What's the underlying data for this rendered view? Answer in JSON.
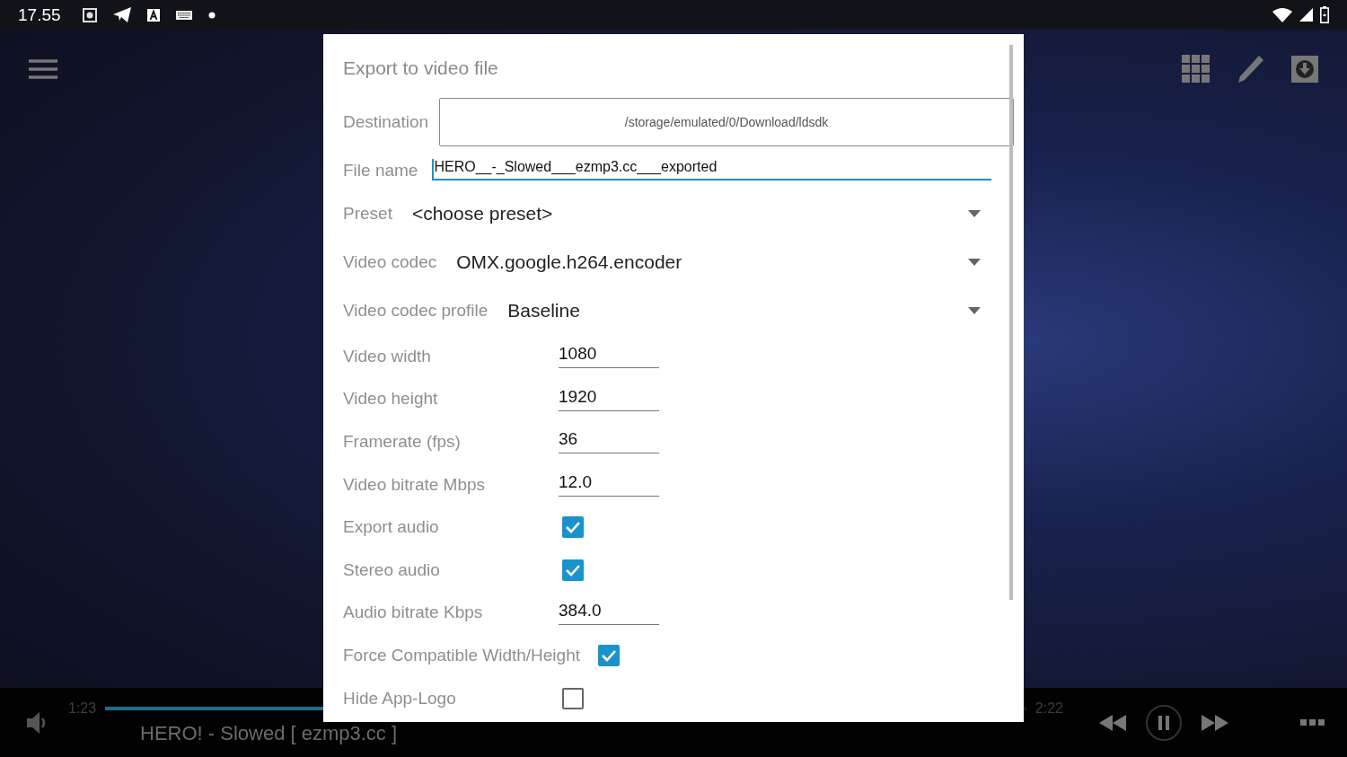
{
  "status_bar": {
    "time": "17.55"
  },
  "dialog": {
    "title": "Export to video file",
    "destination": {
      "label": "Destination",
      "value": "/storage/emulated/0/Download/ldsdk"
    },
    "file_name": {
      "label": "File name",
      "value": "HERO__-_Slowed___ezmp3.cc___exported",
      "focused": true
    },
    "rows": [
      {
        "kind": "dropdown",
        "label": "Preset",
        "value": "<choose preset>"
      },
      {
        "kind": "dropdown",
        "label": "Video codec",
        "value": "OMX.google.h264.encoder"
      },
      {
        "kind": "dropdown",
        "label": "Video codec profile",
        "value": "Baseline"
      },
      {
        "kind": "text",
        "label": "Video width",
        "value": "1080"
      },
      {
        "kind": "text",
        "label": "Video height",
        "value": "1920"
      },
      {
        "kind": "text",
        "label": "Framerate (fps)",
        "value": "36"
      },
      {
        "kind": "text",
        "label": "Video bitrate Mbps",
        "value": "12.0"
      },
      {
        "kind": "checkbox",
        "label": "Export audio",
        "checked": true
      },
      {
        "kind": "checkbox",
        "label": "Stereo audio",
        "checked": true
      },
      {
        "kind": "text",
        "label": "Audio bitrate Kbps",
        "value": "384.0"
      },
      {
        "kind": "checkbox",
        "label": "Force Compatible Width/Height",
        "checked": true
      },
      {
        "kind": "checkbox",
        "label": "Hide App-Logo",
        "checked": false
      }
    ]
  },
  "player": {
    "elapsed": "1:23",
    "duration": "2:22",
    "level": 0.585,
    "track_title": "HERO! - Slowed [ ezmp3.cc ]",
    "playing": true
  }
}
